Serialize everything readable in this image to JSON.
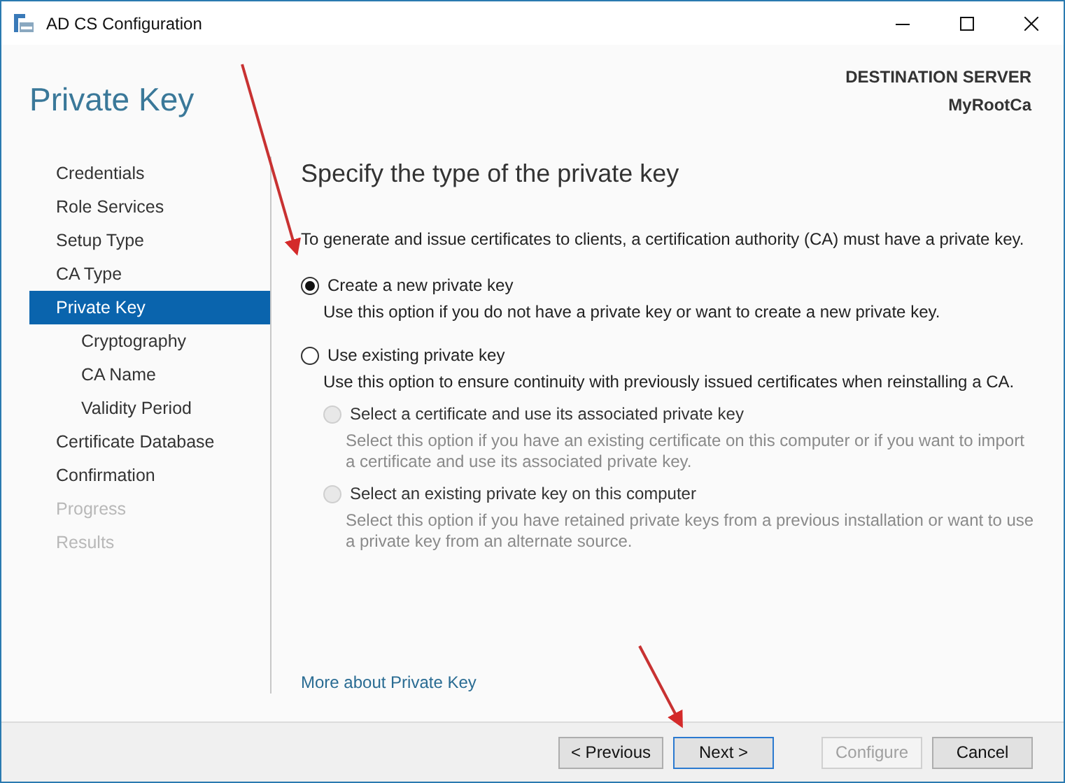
{
  "window": {
    "title": "AD CS Configuration"
  },
  "page_title": "Private Key",
  "destination": {
    "label": "DESTINATION SERVER",
    "server": "MyRootCa"
  },
  "sidebar": {
    "items": [
      {
        "label": "Credentials",
        "selected": false,
        "disabled": false
      },
      {
        "label": "Role Services",
        "selected": false,
        "disabled": false
      },
      {
        "label": "Setup Type",
        "selected": false,
        "disabled": false
      },
      {
        "label": "CA Type",
        "selected": false,
        "disabled": false
      },
      {
        "label": "Private Key",
        "selected": true,
        "disabled": false,
        "children": [
          {
            "label": "Cryptography",
            "selected": false,
            "disabled": false
          },
          {
            "label": "CA Name",
            "selected": false,
            "disabled": false
          },
          {
            "label": "Validity Period",
            "selected": false,
            "disabled": false
          }
        ]
      },
      {
        "label": "Certificate Database",
        "selected": false,
        "disabled": false
      },
      {
        "label": "Confirmation",
        "selected": false,
        "disabled": false
      },
      {
        "label": "Progress",
        "selected": false,
        "disabled": true
      },
      {
        "label": "Results",
        "selected": false,
        "disabled": true
      }
    ]
  },
  "main": {
    "heading": "Specify the type of the private key",
    "intro": "To generate and issue certificates to clients, a certification authority (CA) must have a private key.",
    "options": [
      {
        "label": "Create a new private key",
        "description": "Use this option if you do not have a private key or want to create a new private key.",
        "selected": true,
        "disabled": false
      },
      {
        "label": "Use existing private key",
        "description": "Use this option to ensure continuity with previously issued certificates when reinstalling a CA.",
        "selected": false,
        "disabled": false,
        "children": [
          {
            "label": "Select a certificate and use its associated private key",
            "description": "Select this option if you have an existing certificate on this computer or if you want to import a certificate and use its associated private key.",
            "selected": false,
            "disabled": true
          },
          {
            "label": "Select an existing private key on this computer",
            "description": "Select this option if you have retained private keys from a previous installation or want to use a private key from an alternate source.",
            "selected": false,
            "disabled": true
          }
        ]
      }
    ],
    "link": "More about Private Key"
  },
  "footer": {
    "navigation": [
      {
        "label": "< Previous",
        "disabled": false,
        "default": false
      },
      {
        "label": "Next >",
        "disabled": false,
        "default": true
      }
    ],
    "actions": [
      {
        "label": "Configure",
        "disabled": true,
        "default": false
      },
      {
        "label": "Cancel",
        "disabled": false,
        "default": false
      }
    ]
  }
}
